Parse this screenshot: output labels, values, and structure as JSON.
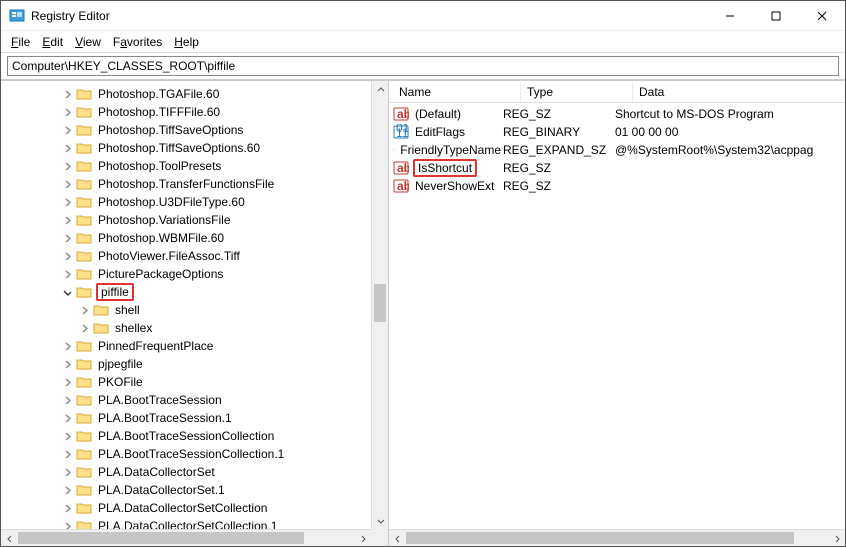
{
  "window_title": "Registry Editor",
  "menu": {
    "file": "File",
    "edit": "Edit",
    "view": "View",
    "favorites": "Favorites",
    "help": "Help"
  },
  "address": "Computer\\HKEY_CLASSES_ROOT\\piffile",
  "tree": {
    "items": [
      {
        "depth": 2,
        "exp": "closed",
        "label": "Photoshop.TGAFile.60"
      },
      {
        "depth": 2,
        "exp": "closed",
        "label": "Photoshop.TIFFFile.60"
      },
      {
        "depth": 2,
        "exp": "closed",
        "label": "Photoshop.TiffSaveOptions"
      },
      {
        "depth": 2,
        "exp": "closed",
        "label": "Photoshop.TiffSaveOptions.60"
      },
      {
        "depth": 2,
        "exp": "closed",
        "label": "Photoshop.ToolPresets"
      },
      {
        "depth": 2,
        "exp": "closed",
        "label": "Photoshop.TransferFunctionsFile"
      },
      {
        "depth": 2,
        "exp": "closed",
        "label": "Photoshop.U3DFileType.60"
      },
      {
        "depth": 2,
        "exp": "closed",
        "label": "Photoshop.VariationsFile"
      },
      {
        "depth": 2,
        "exp": "closed",
        "label": "Photoshop.WBMFile.60"
      },
      {
        "depth": 2,
        "exp": "closed",
        "label": "PhotoViewer.FileAssoc.Tiff"
      },
      {
        "depth": 2,
        "exp": "closed",
        "label": "PicturePackageOptions"
      },
      {
        "depth": 2,
        "exp": "open",
        "label": "piffile",
        "highlight": true
      },
      {
        "depth": 3,
        "exp": "closed",
        "label": "shell"
      },
      {
        "depth": 3,
        "exp": "closed",
        "label": "shellex"
      },
      {
        "depth": 2,
        "exp": "closed",
        "label": "PinnedFrequentPlace"
      },
      {
        "depth": 2,
        "exp": "closed",
        "label": "pjpegfile"
      },
      {
        "depth": 2,
        "exp": "closed",
        "label": "PKOFile"
      },
      {
        "depth": 2,
        "exp": "closed",
        "label": "PLA.BootTraceSession"
      },
      {
        "depth": 2,
        "exp": "closed",
        "label": "PLA.BootTraceSession.1"
      },
      {
        "depth": 2,
        "exp": "closed",
        "label": "PLA.BootTraceSessionCollection"
      },
      {
        "depth": 2,
        "exp": "closed",
        "label": "PLA.BootTraceSessionCollection.1"
      },
      {
        "depth": 2,
        "exp": "closed",
        "label": "PLA.DataCollectorSet"
      },
      {
        "depth": 2,
        "exp": "closed",
        "label": "PLA.DataCollectorSet.1"
      },
      {
        "depth": 2,
        "exp": "closed",
        "label": "PLA.DataCollectorSetCollection"
      },
      {
        "depth": 2,
        "exp": "closed",
        "label": "PLA.DataCollectorSetCollection.1"
      }
    ]
  },
  "list": {
    "headers": {
      "name": "Name",
      "type": "Type",
      "data": "Data"
    },
    "rows": [
      {
        "icon": "str",
        "name": "(Default)",
        "type": "REG_SZ",
        "data": "Shortcut to MS-DOS Program"
      },
      {
        "icon": "bin",
        "name": "EditFlags",
        "type": "REG_BINARY",
        "data": "01 00 00 00"
      },
      {
        "icon": "str",
        "name": "FriendlyTypeName",
        "type": "REG_EXPAND_SZ",
        "data": "@%SystemRoot%\\System32\\acppag"
      },
      {
        "icon": "str",
        "name": "IsShortcut",
        "type": "REG_SZ",
        "data": "",
        "highlight": true
      },
      {
        "icon": "str",
        "name": "NeverShowExt",
        "type": "REG_SZ",
        "data": ""
      }
    ]
  }
}
